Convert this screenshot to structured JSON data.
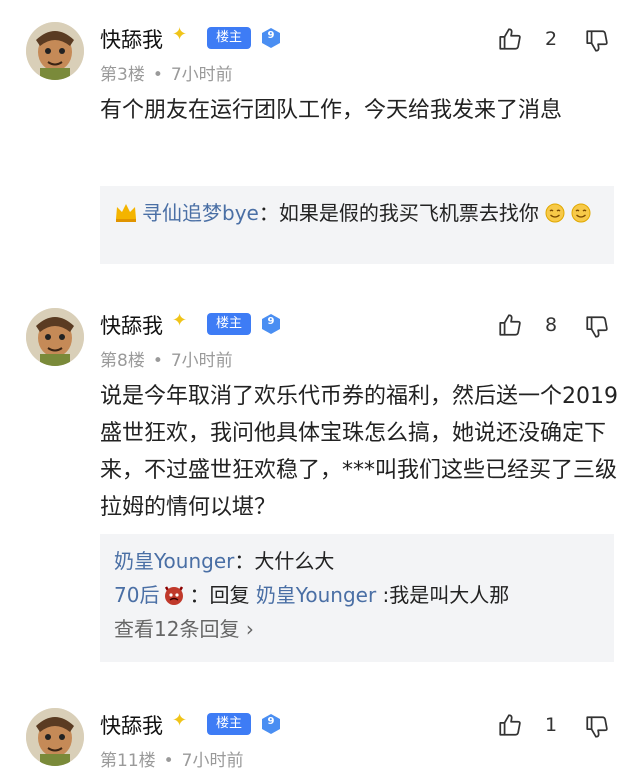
{
  "colors": {
    "accent": "#3e7cf5",
    "reply_name": "#4a6fa5",
    "reply_bg": "#f3f4f6",
    "meta": "#9a9a9a"
  },
  "posts": [
    {
      "username": "快舔我",
      "op_badge": "楼主",
      "level": "9",
      "floor": "第3楼",
      "time": "7小时前",
      "likes": "2",
      "content": "有个朋友在运行团队工作，今天给我发来了消息",
      "replies": [
        {
          "name": "寻仙追梦bye",
          "sep": "：",
          "text": "如果是假的我买飞机票去找你"
        }
      ]
    },
    {
      "username": "快舔我",
      "op_badge": "楼主",
      "level": "9",
      "floor": "第8楼",
      "time": "7小时前",
      "likes": "8",
      "content": "说是今年取消了欢乐代币券的福利，然后送一个2019盛世狂欢，我问他具体宝珠怎么搞，她说还没确定下来，不过盛世狂欢稳了，***叫我们这些已经买了三级拉姆的情何以堪？",
      "replies": [
        {
          "name": "奶皇Younger",
          "sep": "：",
          "text": "大什么大"
        },
        {
          "name": "70后",
          "sep": "：",
          "text_prefix": "回复 ",
          "target": "奶皇Younger",
          "text": " :我是叫大人那"
        }
      ],
      "more_replies": "查看12条回复",
      "more_chevron": "›"
    },
    {
      "username": "快舔我",
      "op_badge": "楼主",
      "level": "9",
      "floor": "第11楼",
      "time": "7小时前",
      "likes": "1"
    }
  ],
  "meta_dot": "•",
  "icons": [
    "avatar",
    "sparkle-icon",
    "level-gem-icon",
    "thumbs-up-icon",
    "thumbs-down-icon",
    "crown-icon",
    "smile-emoji-icon",
    "devil-emoji-icon"
  ]
}
